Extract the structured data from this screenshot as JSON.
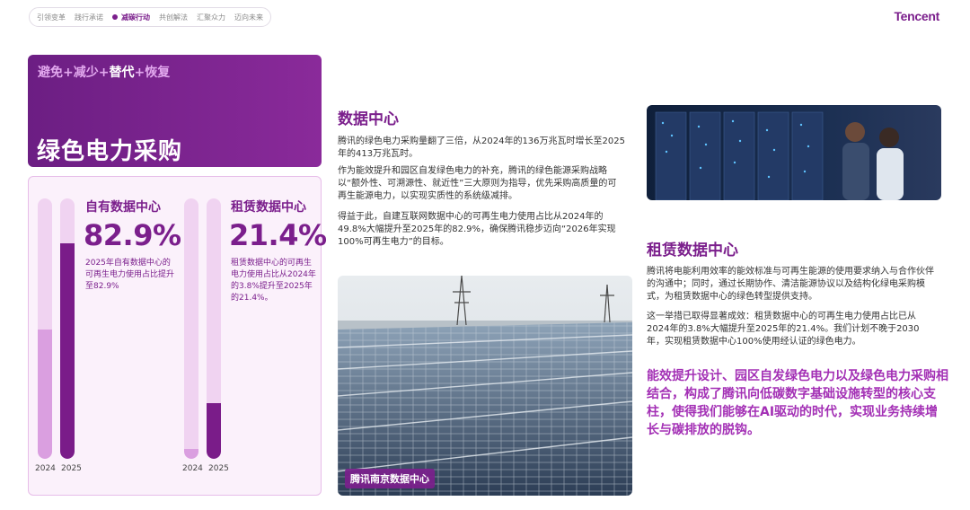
{
  "nav": {
    "items": [
      "引领变革",
      "践行承诺",
      "减碳行动",
      "共创解法",
      "汇聚众力",
      "迈向未来"
    ],
    "active_index": 2
  },
  "brand": "Tencent",
  "title_card": {
    "sub_a": "避免+减少+",
    "sub_b": "替代",
    "sub_c": "+恢复",
    "main": "绿色电力采购"
  },
  "stats": {
    "own": {
      "title": "自有数据中心",
      "value": "82.9%",
      "desc": "2025年自有数据中心的可再生电力使用占比提升至82.9%",
      "bars": [
        {
          "year": "2024",
          "percent": 49.8
        },
        {
          "year": "2025",
          "percent": 82.9
        }
      ]
    },
    "leased": {
      "title": "租赁数据中心",
      "value": "21.4%",
      "desc": "租赁数据中心的可再生电力使用占比从2024年的3.8%提升至2025年的21.4%。",
      "bars": [
        {
          "year": "2024",
          "percent": 3.8
        },
        {
          "year": "2025",
          "percent": 21.4
        }
      ]
    }
  },
  "datacenter": {
    "title": "数据中心",
    "p1": "腾讯的绿色电力采购量翻了三倍，从2024年的136万兆瓦时增长至2025年的413万兆瓦时。",
    "p2": "作为能效提升和园区自发绿色电力的补充，腾讯的绿色能源采购战略以“额外性、可溯源性、就近性”三大原则为指导，优先采购高质量的可再生能源电力，以实现实质性的系统级减排。",
    "p3": "得益于此，自建互联网数据中心的可再生电力使用占比从2024年的49.8%大幅提升至2025年的82.9%，确保腾讯稳步迈向“2026年实现100%可再生电力”的目标。",
    "image_caption": "腾讯南京数据中心"
  },
  "leased_section": {
    "title": "租赁数据中心",
    "p1": "腾讯将电能利用效率的能效标准与可再生能源的使用要求纳入与合作伙伴的沟通中；同时，通过长期协作、清洁能源协议以及结构化绿电采购模式，为租赁数据中心的绿色转型提供支持。",
    "p2": "这一举措已取得显著成效：租赁数据中心的可再生电力使用占比已从2024年的3.8%大幅提升至2025年的21.4%。我们计划不晚于2030年，实现租赁数据中心100%使用经认证的绿色电力。"
  },
  "highlight": "能效提升设计、园区自发绿色电力以及绿色电力采购相结合，构成了腾讯向低碳数字基础设施转型的核心支柱，使得我们能够在AI驱动的时代，实现业务持续增长与碳排放的脱钩。",
  "colors": {
    "brand_purple": "#7b1f8c",
    "light_bar": "#da9fe0",
    "accent_text": "#a330b5"
  }
}
